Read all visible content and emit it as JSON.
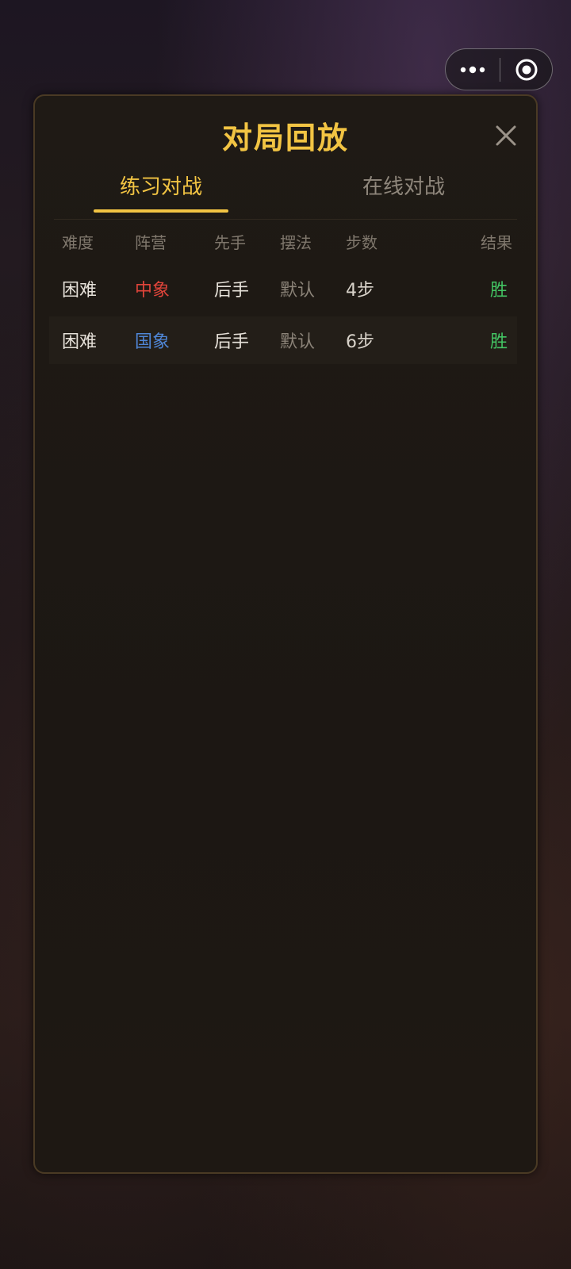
{
  "capsule": {
    "more_icon": "more-dots-icon",
    "target_icon": "target-circle-icon"
  },
  "modal": {
    "title": "对局回放",
    "close_icon": "close-x-icon",
    "tabs": [
      {
        "label": "练习对战",
        "active": true
      },
      {
        "label": "在线对战",
        "active": false
      }
    ],
    "table": {
      "headers": [
        "难度",
        "阵营",
        "先手",
        "摆法",
        "步数",
        "结果"
      ],
      "rows": [
        {
          "difficulty": "困难",
          "camp": "中象",
          "first": "后手",
          "setup": "默认",
          "steps": "4步",
          "result": "胜"
        },
        {
          "difficulty": "困难",
          "camp": "国象",
          "first": "后手",
          "setup": "默认",
          "steps": "6步",
          "result": "胜"
        }
      ]
    }
  },
  "colors": {
    "accent": "#f2c443",
    "camp_chinese": "#e0443a",
    "camp_international": "#4f86d6",
    "result_win": "#43c463"
  }
}
